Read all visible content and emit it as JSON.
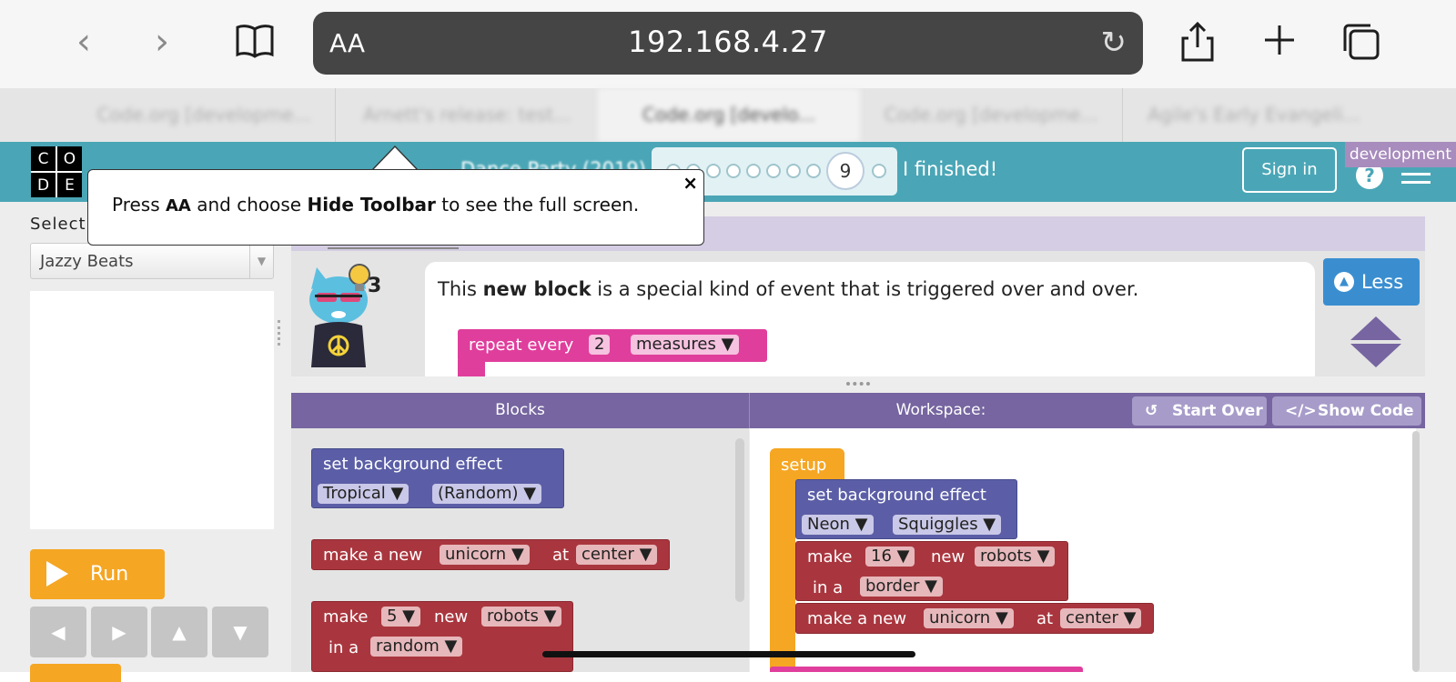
{
  "browser": {
    "text_size_button": "AA",
    "url": "192.168.4.27",
    "tabs": [
      "Code.org [developme...",
      "Arnett's release: test...",
      "Code.org [develo...",
      "Code.org [developme...",
      "Agile's Early Evangeli..."
    ]
  },
  "tooltip": {
    "press": "Press ",
    "aa": "AA",
    "and_choose": " and choose ",
    "hide_toolbar": "Hide Toolbar",
    "rest": " to see the full screen.",
    "close": "×"
  },
  "header": {
    "logo_letters": [
      "C",
      "O",
      "D",
      "E"
    ],
    "level_name": "Dance Party (2019)",
    "current_level": "9",
    "finished_label": "I finished!",
    "sign_in": "Sign in",
    "dev_badge": "development",
    "help": "?"
  },
  "left": {
    "select_label": "Select",
    "song": "Jazzy Beats",
    "run_label": "Run",
    "arrows": [
      "◀",
      "▶",
      "▲",
      "▼"
    ]
  },
  "instructions": {
    "hint_count": "3",
    "text_pre": "This ",
    "text_bold": "new block",
    "text_post": " is a special kind of event that is triggered over and over.",
    "less_label": "Less",
    "example_block": {
      "label": "repeat every",
      "value": "2",
      "unit": "measures ▼"
    }
  },
  "workspace_header": {
    "blocks_label": "Blocks",
    "workspace_label": "Workspace:",
    "start_over": "Start Over",
    "show_code": "Show Code"
  },
  "toolbox": {
    "bg_effect": {
      "label": "set background effect",
      "palette": "Tropical ▼",
      "effect": "(Random) ▼"
    },
    "make_new": {
      "label": "make a new",
      "dancer": "unicorn ▼",
      "at": "at",
      "pos": "center ▼"
    },
    "make_n": {
      "label": "make",
      "count": "5 ▼",
      "new": "new",
      "dancer": "robots ▼",
      "in_a": "in a",
      "layout": "random ▼"
    }
  },
  "workspace": {
    "setup": "setup",
    "bg_effect": {
      "label": "set background effect",
      "palette": "Neon ▼",
      "effect": "Squiggles ▼"
    },
    "make_n": {
      "label": "make",
      "count": "16 ▼",
      "new": "new",
      "dancer": "robots ▼",
      "in_a": "in a",
      "layout": "border ▼"
    },
    "make_new": {
      "label": "make a new",
      "dancer": "unicorn ▼",
      "at": "at",
      "pos": "center ▼"
    }
  }
}
